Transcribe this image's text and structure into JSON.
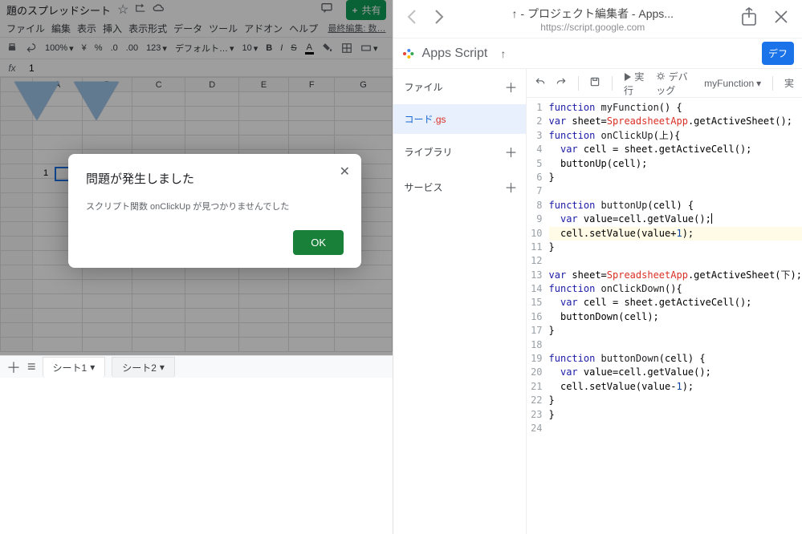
{
  "sheets": {
    "title": "題のスプレッドシート",
    "star_icon": "☆",
    "menu": [
      "ファイル",
      "編集",
      "表示",
      "挿入",
      "表示形式",
      "データ",
      "ツール",
      "アドオン",
      "ヘルプ"
    ],
    "edit_info": "最終編集: 数…",
    "share_label": "共有",
    "zoom": "100%",
    "currency": "¥",
    "percent": "%",
    "dec_dec": ".0",
    "dec_inc": ".00",
    "num_fmt": "123",
    "font": "デフォルト…",
    "font_size": "10",
    "fx_label": "fx",
    "formula_value": "1",
    "cols": [
      "A",
      "B",
      "C",
      "D",
      "E",
      "F",
      "G"
    ],
    "selected_value": "1",
    "tabs": [
      "シート1",
      "シート2"
    ],
    "modal": {
      "title": "問題が発生しました",
      "message": "スクリプト関数 onClickUp が見つかりませんでした",
      "ok": "OK"
    }
  },
  "script": {
    "nav": {
      "title": "↑ - プロジェクト編集者 - Apps...",
      "url": "https://script.google.com"
    },
    "app_name": "Apps Script",
    "deploy": "デフ",
    "sidebar": {
      "files_label": "ファイル",
      "file_name": "コード",
      "file_ext": ".gs",
      "libraries": "ライブラリ",
      "services": "サービス"
    },
    "toolbar": {
      "run": "実行",
      "debug": "デバッグ",
      "fn": "myFunction",
      "log": "実"
    },
    "code": {
      "lines": 24,
      "content": [
        {
          "n": 1,
          "t": [
            [
              "kw",
              "function"
            ],
            [
              "",
              " "
            ],
            [
              "fn2",
              "myFunction"
            ],
            [
              "",
              "() {"
            ]
          ]
        },
        {
          "n": 2,
          "t": [
            [
              "kw",
              "var"
            ],
            [
              "",
              " sheet="
            ],
            [
              "cls",
              "SpreadsheetApp"
            ],
            [
              "",
              ".getActiveSheet();"
            ]
          ]
        },
        {
          "n": 3,
          "t": [
            [
              "kw",
              "function"
            ],
            [
              "",
              " "
            ],
            [
              "fn2",
              "onClickUp"
            ],
            [
              "",
              "("
            ],
            [
              "fn2",
              "上"
            ],
            [
              "",
              ")"
            ],
            [
              "",
              "{"
            ]
          ]
        },
        {
          "n": 4,
          "t": [
            [
              "",
              "  "
            ],
            [
              "kw",
              "var"
            ],
            [
              "",
              " cell = sheet.getActiveCell();"
            ]
          ]
        },
        {
          "n": 5,
          "t": [
            [
              "",
              "  buttonUp(cell);"
            ]
          ]
        },
        {
          "n": 6,
          "t": [
            [
              "",
              "}"
            ]
          ]
        },
        {
          "n": 7,
          "t": []
        },
        {
          "n": 8,
          "t": [
            [
              "kw",
              "function"
            ],
            [
              "",
              " "
            ],
            [
              "fn2",
              "buttonUp"
            ],
            [
              "",
              "(cell) {"
            ]
          ]
        },
        {
          "n": 9,
          "t": [
            [
              "",
              "  "
            ],
            [
              "kw",
              "var"
            ],
            [
              "",
              " value=cell.getValue();"
            ]
          ]
        },
        {
          "n": 10,
          "t": [
            [
              "",
              "  cell.setValue(value+"
            ],
            [
              "num",
              "1"
            ],
            [
              "",
              ");"
            ]
          ]
        },
        {
          "n": 11,
          "t": [
            [
              "",
              "}"
            ]
          ]
        },
        {
          "n": 12,
          "t": []
        },
        {
          "n": 13,
          "t": [
            [
              "kw",
              "var"
            ],
            [
              "",
              " sheet="
            ],
            [
              "cls",
              "SpreadsheetApp"
            ],
            [
              "",
              ".getActiveSheet("
            ],
            [
              "fn2",
              "下"
            ],
            [
              "",
              ");"
            ]
          ]
        },
        {
          "n": 14,
          "t": [
            [
              "kw",
              "function"
            ],
            [
              "",
              " "
            ],
            [
              "fn2",
              "onClickDown"
            ],
            [
              "",
              "(){"
            ]
          ]
        },
        {
          "n": 15,
          "t": [
            [
              "",
              "  "
            ],
            [
              "kw",
              "var"
            ],
            [
              "",
              " cell = sheet.getActiveCell();"
            ]
          ]
        },
        {
          "n": 16,
          "t": [
            [
              "",
              "  buttonDown(cell);"
            ]
          ]
        },
        {
          "n": 17,
          "t": [
            [
              "",
              "}"
            ]
          ]
        },
        {
          "n": 18,
          "t": []
        },
        {
          "n": 19,
          "t": [
            [
              "kw",
              "function"
            ],
            [
              "",
              " "
            ],
            [
              "fn2",
              "buttonDown"
            ],
            [
              "",
              "(cell) {"
            ]
          ]
        },
        {
          "n": 20,
          "t": [
            [
              "",
              "  "
            ],
            [
              "kw",
              "var"
            ],
            [
              "",
              " value=cell.getValue();"
            ]
          ]
        },
        {
          "n": 21,
          "t": [
            [
              "",
              "  cell.setValue(value-"
            ],
            [
              "num",
              "1"
            ],
            [
              "",
              ");"
            ]
          ]
        },
        {
          "n": 22,
          "t": [
            [
              "",
              "}"
            ]
          ]
        },
        {
          "n": 23,
          "t": [
            [
              "",
              "}"
            ]
          ]
        },
        {
          "n": 24,
          "t": []
        }
      ]
    }
  }
}
